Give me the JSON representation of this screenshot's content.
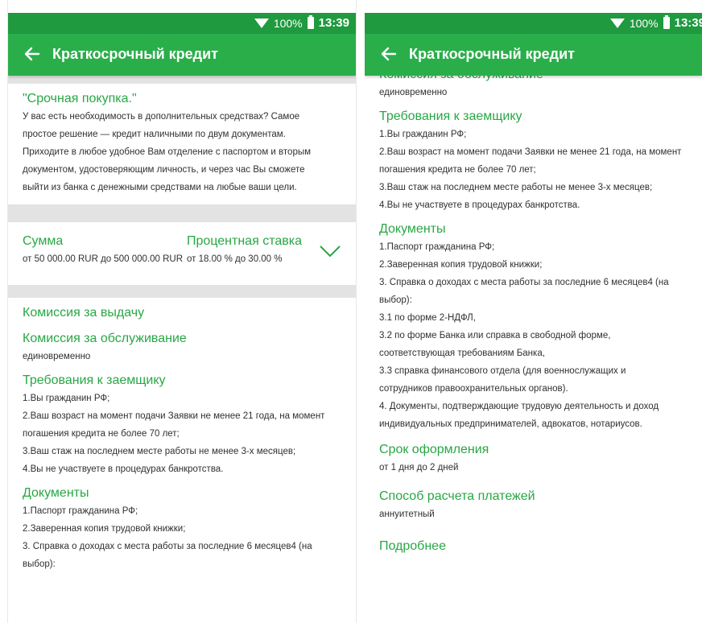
{
  "status": {
    "battery": "100%",
    "time": "13:39"
  },
  "appbar": {
    "title": "Краткосрочный кредит"
  },
  "intro": {
    "title": "\"Срочная покупка.\"",
    "lines": [
      "У вас есть необходимость в дополнительных средствах? Самое",
      "простое решение — кредит наличными по двум документам.",
      "Приходите в любое удобное Вам отделение с паспортом и вторым",
      "документом, удостоверяющим личность, и через час Вы сможете",
      "выйти из банка с денежными средствами на любые ваши цели."
    ]
  },
  "rates": {
    "sum_label": "Сумма",
    "sum_value": "от 50 000.00 RUR до 500 000.00 RUR",
    "rate_label": "Процентная ставка",
    "rate_value": "от 18.00 % до 30.00 %"
  },
  "details": {
    "fee_issue": "Комиссия за выдачу",
    "fee_service": "Комиссия за обслуживание",
    "fee_service_value": "единовременно",
    "requirements_title": "Требования к заемщику",
    "requirements": [
      "1.Вы гражданин РФ;",
      "2.Ваш возраст на момент подачи Заявки не менее 21 года, на момент",
      "погашения кредита не более 70 лет;",
      "3.Ваш стаж на последнем месте работы не менее 3-х месяцев;",
      "4.Вы не участвуете в процедурах банкротства."
    ],
    "documents_title": "Документы",
    "documents": [
      "1.Паспорт гражданина РФ;",
      "2.Заверенная копия трудовой книжки;",
      "3. Справка о доходах с места работы за последние 6 месяцев4 (на",
      "выбор):",
      "3.1 по форме 2-НДФЛ,",
      "3.2 по форме Банка или справка в свободной форме,",
      "соответствующая требованиям Банка,",
      "3.3 справка финансового отдела (для военнослужащих и",
      "сотрудников правоохранительных органов).",
      "4. Документы, подтверждающие трудовую деятельность и доход",
      "индивидуальных предпринимателей, адвокатов, нотариусов."
    ],
    "term_title": "Срок оформления",
    "term_value": "от 1 дня до 2 дней",
    "payment_title": "Способ расчета платежей",
    "payment_value": "аннуитетный",
    "more_title": "Подробнее"
  }
}
